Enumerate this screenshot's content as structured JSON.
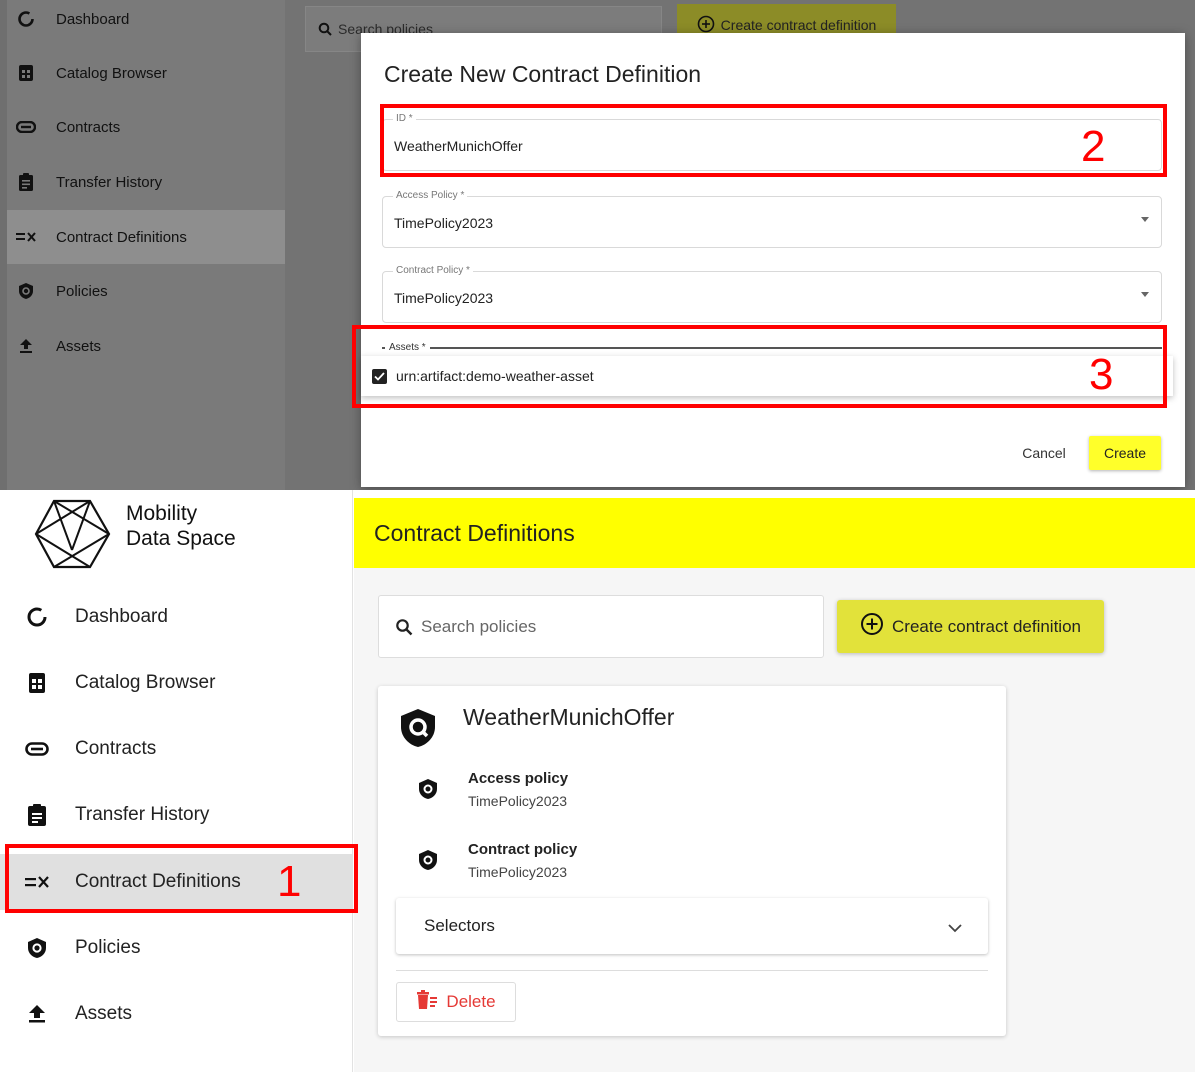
{
  "top": {
    "nav": [
      {
        "label": "Dashboard",
        "icon": "dashboard-icon"
      },
      {
        "label": "Catalog Browser",
        "icon": "catalog-icon"
      },
      {
        "label": "Contracts",
        "icon": "contracts-icon"
      },
      {
        "label": "Transfer History",
        "icon": "clipboard-icon"
      },
      {
        "label": "Contract Definitions",
        "icon": "contract-definitions-icon",
        "active": true
      },
      {
        "label": "Policies",
        "icon": "policy-shield-icon"
      },
      {
        "label": "Assets",
        "icon": "upload-icon"
      }
    ],
    "search_placeholder": "Search policies",
    "create_label": "Create contract definition",
    "modal": {
      "title": "Create New Contract Definition",
      "id_label": "ID *",
      "id_value": "WeatherMunichOffer",
      "access_label": "Access Policy *",
      "access_value": "TimePolicy2023",
      "contract_label": "Contract Policy *",
      "contract_value": "TimePolicy2023",
      "assets_label": "Assets *",
      "asset_option": "urn:artifact:demo-weather-asset",
      "cancel_label": "Cancel",
      "create_label": "Create"
    },
    "annotations": {
      "two": "2",
      "three": "3"
    }
  },
  "bottom": {
    "brand_line1": "Mobility",
    "brand_line2": "Data Space",
    "nav": [
      {
        "label": "Dashboard"
      },
      {
        "label": "Catalog Browser"
      },
      {
        "label": "Contracts"
      },
      {
        "label": "Transfer History"
      },
      {
        "label": "Contract Definitions",
        "active": true
      },
      {
        "label": "Policies"
      },
      {
        "label": "Assets"
      }
    ],
    "header_title": "Contract Definitions",
    "search_placeholder": "Search policies",
    "create_label": "Create contract definition",
    "card": {
      "title": "WeatherMunichOffer",
      "access_heading": "Access policy",
      "access_value": "TimePolicy2023",
      "contract_heading": "Contract policy",
      "contract_value": "TimePolicy2023",
      "selectors_label": "Selectors",
      "delete_label": "Delete"
    },
    "annotations": {
      "one": "1"
    }
  },
  "colors": {
    "accent_yellow": "#ffff00",
    "button_yellow": "#e2e23a",
    "annotation_red": "#ff0000",
    "delete_red": "#e53935"
  }
}
